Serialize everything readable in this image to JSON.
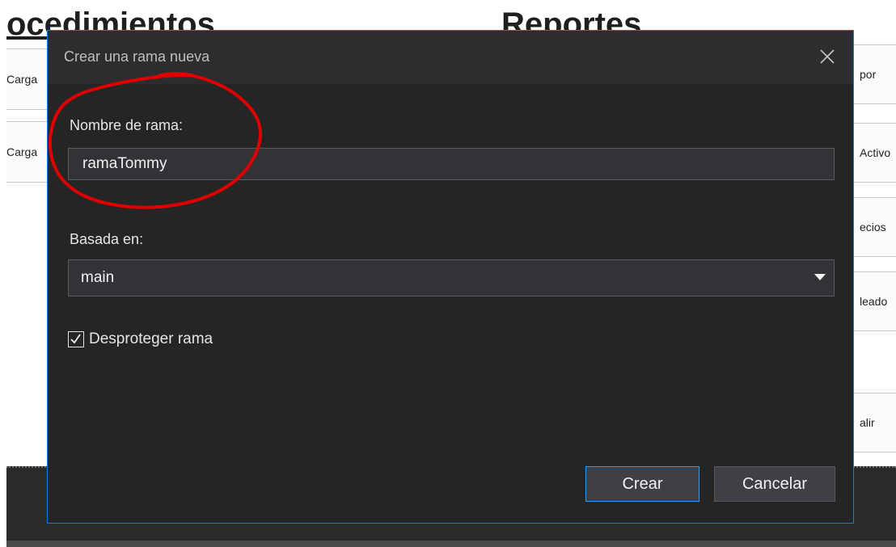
{
  "background": {
    "heading_left": "ocedimientos",
    "heading_right": "Reportes",
    "left_rows": [
      "Carga",
      "Carga"
    ],
    "right_rows": [
      "por",
      "Activo",
      "ecios",
      "leado",
      "alir"
    ]
  },
  "dialog": {
    "title": "Crear una rama nueva",
    "branch_name_label": "Nombre de rama:",
    "branch_name_value": "ramaTommy",
    "based_on_label": "Basada en:",
    "based_on_value": "main",
    "checkout_label": "Desproteger rama",
    "checkout_checked": true,
    "create_button": "Crear",
    "cancel_button": "Cancelar"
  },
  "colors": {
    "dialog_bg": "#252526",
    "dialog_border": "#1f7ad8",
    "annotation": "#e00000"
  },
  "icons": {
    "close": "close-icon",
    "dropdown": "chevron-down-icon",
    "check": "checkmark-icon"
  }
}
